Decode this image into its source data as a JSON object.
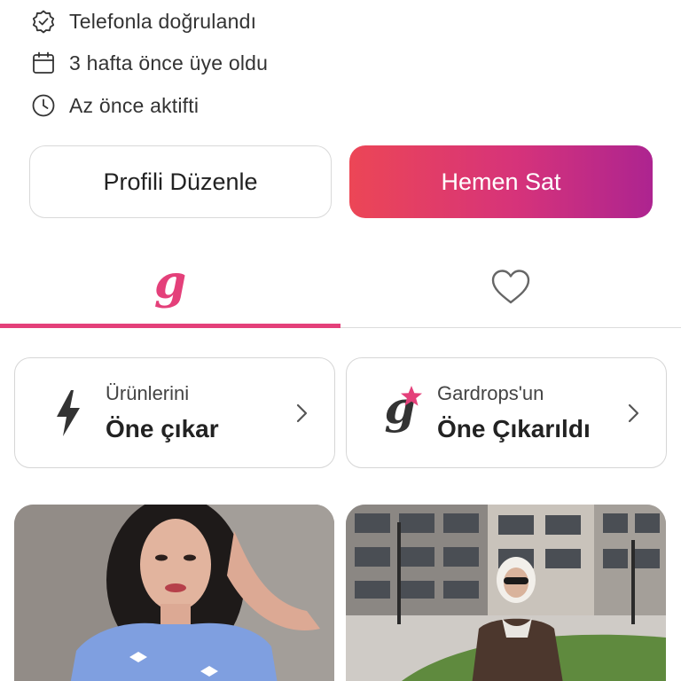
{
  "profile_info": [
    {
      "icon": "verified-badge-icon",
      "text": "Telefonla doğrulandı"
    },
    {
      "icon": "calendar-icon",
      "text": "3 hafta önce üye oldu"
    },
    {
      "icon": "clock-icon",
      "text": "Az önce aktifti"
    }
  ],
  "actions": {
    "edit_profile": "Profili Düzenle",
    "sell_now": "Hemen Sat"
  },
  "tabs": [
    {
      "icon": "gardrops-g-logo-icon",
      "glyph": "g",
      "active": true
    },
    {
      "icon": "heart-icon",
      "active": false
    }
  ],
  "promo_cards": [
    {
      "icon": "lightning-icon",
      "subtitle": "Ürünlerini",
      "title": "Öne çıkar"
    },
    {
      "icon": "gardrops-star-logo-icon",
      "glyph": "g",
      "subtitle": "Gardrops'un",
      "title": "Öne Çıkarıldı"
    }
  ],
  "listings": [
    {
      "image": "product-photo-blue-top"
    },
    {
      "image": "product-photo-brown-outfit"
    }
  ],
  "colors": {
    "accent": "#e4407a",
    "gradient_start": "#ec4656",
    "gradient_end": "#ad2490",
    "text": "#222222"
  }
}
